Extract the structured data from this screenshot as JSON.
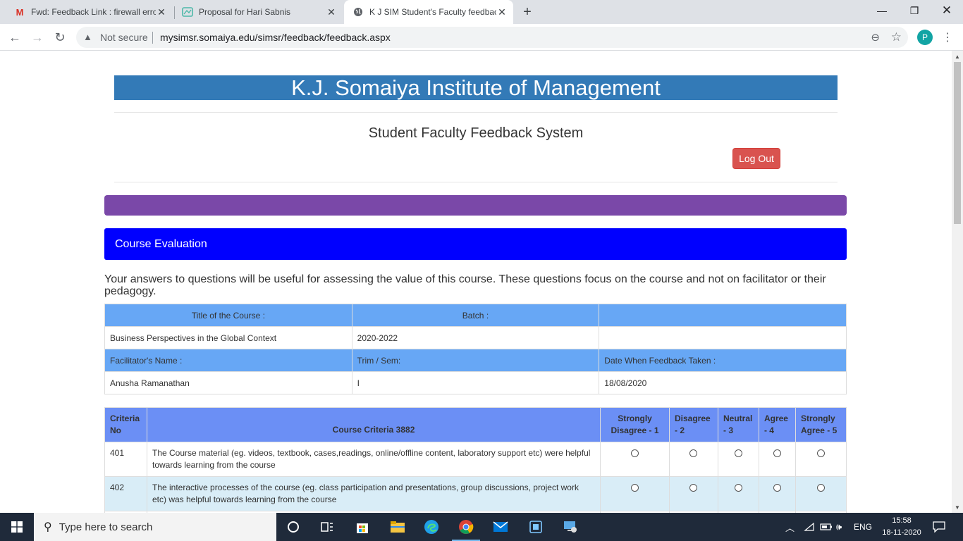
{
  "browser": {
    "tabs": [
      {
        "title": "Fwd: Feedback Link : firewall erro",
        "favicon": "gmail-icon"
      },
      {
        "title": "Proposal for Hari Sabnis",
        "favicon": "map-icon"
      },
      {
        "title": "K J SIM Student's Faculty feedbac",
        "favicon": "globe-icon"
      }
    ],
    "security_label": "Not secure",
    "url": "mysimsr.somaiya.edu/simsr/feedback/feedback.aspx",
    "profile_initial": "P"
  },
  "page": {
    "institute": "K.J. Somaiya Institute of Management",
    "system_title": "Student Faculty Feedback System",
    "logout_label": "Log Out",
    "panel_title": "Course Evaluation",
    "intro": "Your answers to questions will be useful for assessing the value of this course. These questions focus on the course and not on facilitator or their pedagogy."
  },
  "info_table": {
    "row1": [
      "Title of the Course :",
      "Batch :",
      ""
    ],
    "row2": [
      "Business Perspectives in the Global Context",
      "2020-2022",
      ""
    ],
    "row3": [
      "Facilitator's Name :",
      "Trim / Sem:",
      "Date When Feedback Taken :"
    ],
    "row4": [
      "Anusha Ramanathan",
      "I",
      "18/08/2020"
    ]
  },
  "criteria_table": {
    "headers": {
      "no": "Criteria No",
      "criteria": "Course Criteria 3882",
      "sd": "Strongly Disagree - 1",
      "d": "Disagree - 2",
      "n": "Neutral - 3",
      "a": "Agree - 4",
      "sa": "Strongly Agree - 5"
    },
    "rows": [
      {
        "no": "401",
        "text": "The Course material (eg. videos, textbook, cases,readings, online/offline content, laboratory support etc) were helpful towards learning from the course"
      },
      {
        "no": "402",
        "text": "The interactive processes of the course (eg. class participation and presentations, group discussions, project work etc) was helpful towards learning from the course"
      }
    ]
  },
  "taskbar": {
    "search_placeholder": "Type here to search",
    "language": "ENG",
    "time": "15:58",
    "date": "18-11-2020"
  }
}
